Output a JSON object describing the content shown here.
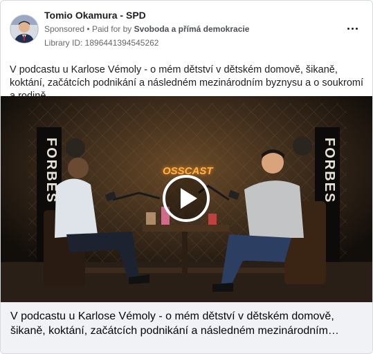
{
  "header": {
    "page_name": "Tomio Okamura - SPD",
    "sponsored_label": "Sponsored",
    "separator": "•",
    "paid_for_prefix": "Paid for by",
    "payer": "Svoboda a přímá demokracie",
    "library_id": "Library ID: 1896441394545262",
    "more_icon": "more-horizontal-icon"
  },
  "post": {
    "text": "V podcastu u Karlose Vémoly - o mém dětství v dětském domově, šikaně, koktání, začátcích podnikání a následném mezinárodním byznysu a o soukromí a rodině."
  },
  "media": {
    "type": "video",
    "play_icon": "play-icon",
    "banner_left": "FORBES",
    "banner_right": "FORBES",
    "sign_text": "OSSCAST"
  },
  "caption": {
    "text": "V podcastu u Karlose Vémoly - o mém dětství v dětském domově, šikaně, koktání, začátcích podnikání a následném mezinárodním…"
  },
  "colors": {
    "meta_gray": "#65676b",
    "caption_bg": "#f0f2f5",
    "studio_bg": "#1d1813"
  }
}
